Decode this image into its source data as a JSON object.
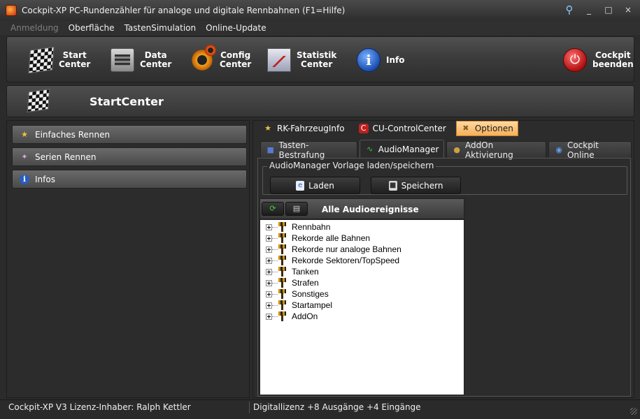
{
  "window": {
    "title": "Cockpit-XP PC-Rundenzähler für analoge und digitale Rennbahnen (F1=Hilfe)",
    "controls": {
      "minimize": "_",
      "maximize": "□",
      "close": "×"
    }
  },
  "menu": [
    "Anmeldung",
    "Oberfläche",
    "TastenSimulation",
    "Online-Update"
  ],
  "toolbar": {
    "items": [
      {
        "label": "Start\nCenter",
        "icon": "checkered-flag-icon"
      },
      {
        "label": "Data\nCenter",
        "icon": "server-icon"
      },
      {
        "label": "Config\nCenter",
        "icon": "gears-icon"
      },
      {
        "label": "Statistik\nCenter",
        "icon": "chart-icon"
      },
      {
        "label": "Info",
        "icon": "info-icon"
      },
      {
        "label": "Cockpit\nbeenden",
        "icon": "power-icon"
      }
    ]
  },
  "header": {
    "title": "StartCenter"
  },
  "sidebar": {
    "items": [
      {
        "label": "Einfaches Rennen",
        "icon": "race-icon"
      },
      {
        "label": "Serien Rennen",
        "icon": "series-icon"
      },
      {
        "label": "Infos",
        "icon": "info-icon"
      }
    ]
  },
  "top_tabs": [
    {
      "label": "RK-FahrzeugInfo",
      "icon": "star-icon"
    },
    {
      "label": "CU-ControlCenter",
      "icon": "cu-icon"
    },
    {
      "label": "Optionen",
      "icon": "tools-icon",
      "active": true
    }
  ],
  "sub_tabs": [
    {
      "label": "Tasten-Bestrafung",
      "icon": "car-icon"
    },
    {
      "label": "AudioManager",
      "icon": "waveform-icon",
      "active": true
    },
    {
      "label": "AddOn Aktivierung",
      "icon": "addon-icon"
    },
    {
      "label": "Cockpit Online",
      "icon": "globe-icon"
    }
  ],
  "audio_group": {
    "legend": "AudioManager Vorlage laden/speichern",
    "load_label": "Laden",
    "save_label": "Speichern"
  },
  "tree": {
    "title": "Alle Audioereignisse",
    "items": [
      "Rennbahn",
      "Rekorde alle Bahnen",
      "Rekorde nur analoge Bahnen",
      "Rekorde Sektoren/TopSpeed",
      "Tanken",
      "Strafen",
      "Sonstiges",
      "Startampel",
      "AddOn"
    ]
  },
  "status": {
    "left": "Cockpit-XP V3 Lizenz-Inhaber: Ralph Kettler",
    "right": "Digitallizenz  +8 Ausgänge +4 Eingänge"
  }
}
